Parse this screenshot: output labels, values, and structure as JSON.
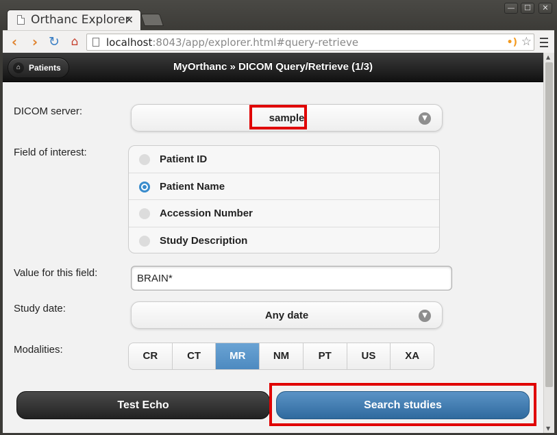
{
  "browser": {
    "tab_title": "Orthanc Explorer",
    "tab_close": "✕",
    "window_min": "—",
    "window_max": "☐",
    "window_close": "✕",
    "url_host": "localhost",
    "url_rest": ":8043/app/explorer.html#query-retrieve"
  },
  "header": {
    "back_button_label": "Patients",
    "title": "MyOrthanc » DICOM Query/Retrieve (1/3)"
  },
  "form": {
    "server_label": "DICOM server:",
    "server_value": "sample",
    "field_label": "Field of interest:",
    "field_options": [
      {
        "label": "Patient ID",
        "selected": false
      },
      {
        "label": "Patient Name",
        "selected": true
      },
      {
        "label": "Accession Number",
        "selected": false
      },
      {
        "label": "Study Description",
        "selected": false
      }
    ],
    "value_label": "Value for this field:",
    "value_input": "BRAIN*",
    "date_label": "Study date:",
    "date_value": "Any date",
    "modalities_label": "Modalities:",
    "modalities": [
      {
        "label": "CR",
        "active": false
      },
      {
        "label": "CT",
        "active": false
      },
      {
        "label": "MR",
        "active": true
      },
      {
        "label": "NM",
        "active": false
      },
      {
        "label": "PT",
        "active": false
      },
      {
        "label": "US",
        "active": false
      },
      {
        "label": "XA",
        "active": false
      }
    ]
  },
  "actions": {
    "echo_label": "Test Echo",
    "search_label": "Search studies"
  },
  "colors": {
    "highlight": "#e00000",
    "accent": "#3a8ccc"
  }
}
